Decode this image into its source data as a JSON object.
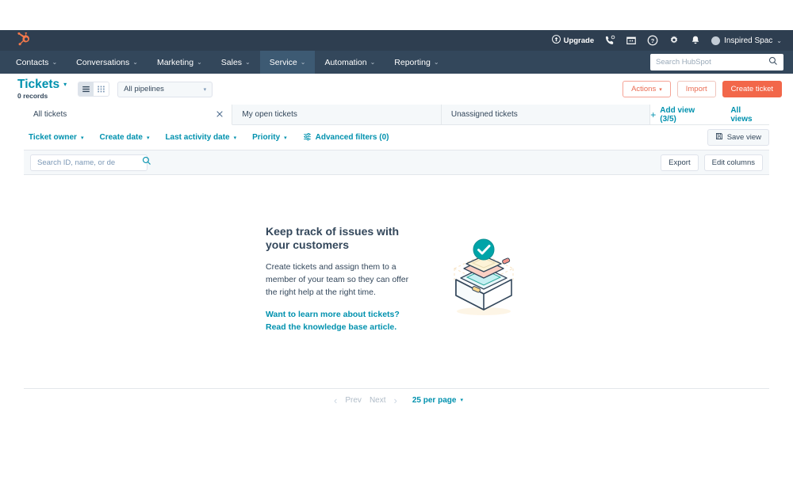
{
  "utility_bar": {
    "logo_icon": "hubspot-sprocket-logo",
    "upgrade_label": "Upgrade",
    "upgrade_icon": "upgrade-arrow-icon",
    "icons": [
      "phone-icon",
      "marketplace-icon",
      "help-circle-icon",
      "gear-icon",
      "bell-icon"
    ],
    "account_name": "Inspired Spac",
    "account_caret": "⌄"
  },
  "main_nav": {
    "items": [
      {
        "label": "Contacts",
        "caret": "⌄",
        "active": false
      },
      {
        "label": "Conversations",
        "caret": "⌄",
        "active": false
      },
      {
        "label": "Marketing",
        "caret": "⌄",
        "active": false
      },
      {
        "label": "Sales",
        "caret": "⌄",
        "active": false
      },
      {
        "label": "Service",
        "caret": "⌄",
        "active": true
      },
      {
        "label": "Automation",
        "caret": "⌄",
        "active": false
      },
      {
        "label": "Reporting",
        "caret": "⌄",
        "active": false
      }
    ],
    "search_placeholder": "Search HubSpot",
    "search_value": "",
    "search_icon": "search-icon"
  },
  "page_header": {
    "title": "Tickets",
    "title_caret": "▾",
    "record_count": "0 records",
    "view_toggle": {
      "list_icon": "list-view-icon",
      "board_icon": "board-view-icon",
      "selected": "list"
    },
    "pipeline_select": {
      "value": "All pipelines",
      "caret": "▾"
    },
    "actions_label": "Actions",
    "actions_caret": "▾",
    "import_label": "Import",
    "create_label": "Create ticket"
  },
  "view_tabs": {
    "tabs": [
      {
        "label": "All tickets",
        "active": true,
        "closable": true,
        "close_icon": "close-icon"
      },
      {
        "label": "My open tickets",
        "active": false,
        "closable": false
      },
      {
        "label": "Unassigned tickets",
        "active": false,
        "closable": false
      }
    ],
    "add_view_label": "Add view (3/5)",
    "add_view_icon": "plus-icon",
    "all_views_label": "All views"
  },
  "filter_bar": {
    "filters": [
      {
        "label": "Ticket owner",
        "caret": "▾"
      },
      {
        "label": "Create date",
        "caret": "▾"
      },
      {
        "label": "Last activity date",
        "caret": "▾"
      },
      {
        "label": "Priority",
        "caret": "▾"
      }
    ],
    "advanced_filters_label": "Advanced filters (0)",
    "advanced_filters_icon": "sliders-icon",
    "save_view_label": "Save view",
    "save_view_icon": "save-disk-icon"
  },
  "table_controls": {
    "search_placeholder": "Search ID, name, or de",
    "search_value": "",
    "search_icon": "search-icon",
    "export_label": "Export",
    "edit_columns_label": "Edit columns"
  },
  "empty_state": {
    "heading": "Keep track of issues with your customers",
    "body": "Create tickets and assign them to a member of your team so they can offer the right help at the right time.",
    "link": "Want to learn more about tickets? Read the knowledge base article.",
    "illustration_icon": "tickets-box-check-illustration"
  },
  "pagination": {
    "prev_label": "Prev",
    "next_label": "Next",
    "prev_icon": "chevron-left-icon",
    "next_icon": "chevron-right-icon",
    "per_page_label": "25 per page",
    "per_page_caret": "▾"
  },
  "colors": {
    "nav_dark": "#33475b",
    "utility_dark": "#2e3e50",
    "teal": "#0091ae",
    "orange": "#f2674a",
    "text": "#33475b",
    "panel": "#f5f8fa",
    "border": "#e3e7eb"
  }
}
